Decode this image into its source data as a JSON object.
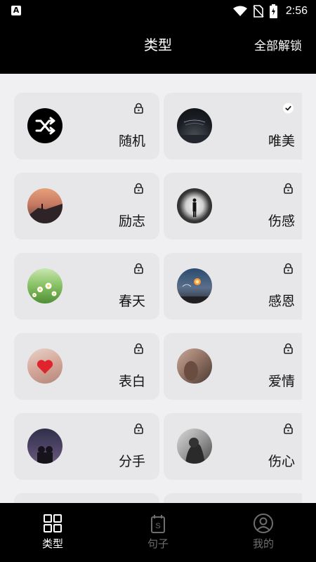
{
  "status_bar": {
    "left_icon": "A",
    "time": "2:56",
    "icons": [
      "wifi-icon",
      "no-sim-icon",
      "battery-charging-icon"
    ]
  },
  "header": {
    "title": "类型",
    "unlock_all": "全部解锁"
  },
  "categories": [
    {
      "label": "随机",
      "thumb": "shuffle-icon",
      "state": "locked"
    },
    {
      "label": "唯美",
      "thumb": "night-sky-photo",
      "state": "selected"
    },
    {
      "label": "励志",
      "thumb": "sunset-cliff-photo",
      "state": "locked"
    },
    {
      "label": "伤感",
      "thumb": "tunnel-silhouette-photo",
      "state": "locked"
    },
    {
      "label": "春天",
      "thumb": "daisies-photo",
      "state": "locked"
    },
    {
      "label": "感恩",
      "thumb": "sparkler-photo",
      "state": "locked"
    },
    {
      "label": "表白",
      "thumb": "heart-hands-photo",
      "state": "locked"
    },
    {
      "label": "爱情",
      "thumb": "couple-photo",
      "state": "locked"
    },
    {
      "label": "分手",
      "thumb": "couple-dusk-photo",
      "state": "locked"
    },
    {
      "label": "伤心",
      "thumb": "sad-girl-photo",
      "state": "locked"
    }
  ],
  "bottom_nav": [
    {
      "label": "类型",
      "icon": "grid-icon",
      "active": true
    },
    {
      "label": "句子",
      "icon": "sentence-icon",
      "active": false
    },
    {
      "label": "我的",
      "icon": "profile-icon",
      "active": false
    }
  ],
  "colors": {
    "background": "#000000",
    "content_bg": "#f0f0f2",
    "card_bg": "#e7e7e9",
    "text": "#111111",
    "nav_active": "#ffffff",
    "nav_inactive": "#6e6e6e"
  }
}
